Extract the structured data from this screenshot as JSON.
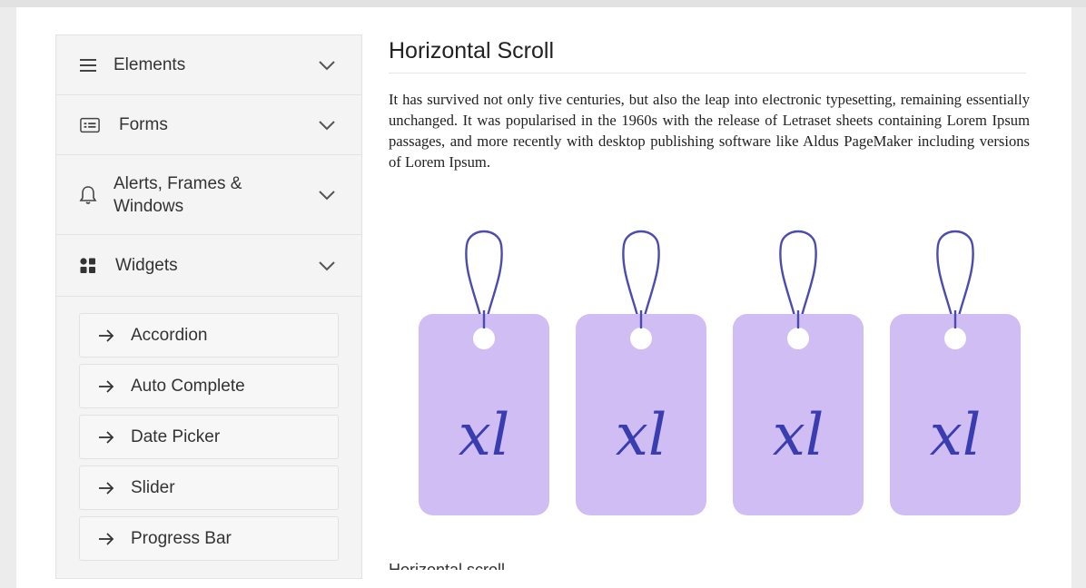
{
  "sidebar": {
    "groups": [
      {
        "label": "Elements",
        "icon": "menu-icon"
      },
      {
        "label": "Forms",
        "icon": "form-icon"
      },
      {
        "label_line1": "Alerts, Frames &",
        "label_line2": "Windows",
        "icon": "bell-icon"
      },
      {
        "label": "Widgets",
        "icon": "widgets-icon"
      }
    ],
    "widget_items": [
      {
        "label": "Accordion"
      },
      {
        "label": "Auto Complete"
      },
      {
        "label": "Date Picker"
      },
      {
        "label": "Slider"
      },
      {
        "label": "Progress Bar"
      }
    ]
  },
  "main": {
    "title": "Horizontal Scroll",
    "paragraph": "It has survived not only five centuries, but also the leap into electronic typesetting, remaining essentially unchanged. It was popularised in the 1960s with the release of Letraset sheets containing Lorem Ipsum passages, and more recently with desktop publishing software like Aldus PageMaker including versions of Lorem Ipsum.",
    "tags": [
      {
        "text": "xl"
      },
      {
        "text": "xl"
      },
      {
        "text": "xl"
      },
      {
        "text": "xl"
      }
    ],
    "bottom_heading": "Horizontal scroll"
  },
  "colors": {
    "tag_fill": "#d0bdf4",
    "tag_ink": "#3a3db0",
    "string": "#4b4bb0"
  }
}
